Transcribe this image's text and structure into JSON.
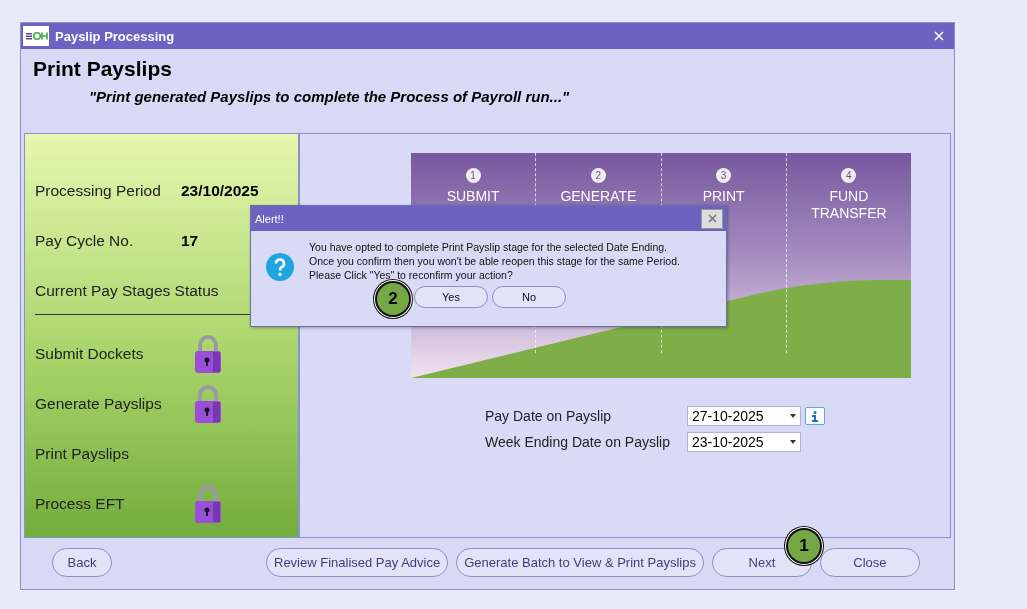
{
  "window": {
    "title": "Payslip Processing"
  },
  "header": {
    "title": "Print Payslips",
    "subtitle": "\"Print generated Payslips to complete the Process of Payroll run...\""
  },
  "summary": [
    {
      "label": "Processing Period",
      "value": "23/10/2025"
    },
    {
      "label": "Pay Cycle No.",
      "value": "17"
    }
  ],
  "status_heading": "Current Pay Stages Status",
  "stages": [
    {
      "label": "Submit Dockets",
      "locked": true
    },
    {
      "label": "Generate Payslips",
      "locked": true
    },
    {
      "label": "Print Payslips",
      "locked": false
    },
    {
      "label": "Process EFT",
      "locked": true
    }
  ],
  "banner_steps": [
    {
      "number": "1",
      "label": "SUBMIT"
    },
    {
      "number": "2",
      "label": "GENERATE"
    },
    {
      "number": "3",
      "label": "PRINT"
    },
    {
      "number": "4",
      "label": "FUND TRANSFER"
    }
  ],
  "fields": [
    {
      "label": "Pay Date on Payslip",
      "value": "27-10-2025",
      "info": true
    },
    {
      "label": "Week Ending Date on Payslip",
      "value": "23-10-2025",
      "info": false
    }
  ],
  "buttons": [
    {
      "label": "Back"
    },
    {
      "label": "Review Finalised Pay Advice"
    },
    {
      "label": "Generate Batch to View & Print Payslips"
    },
    {
      "label": "Next"
    },
    {
      "label": "Close"
    }
  ],
  "dialog": {
    "title": "Alert!!",
    "message": "You have opted to complete Print Payslip stage for the selected Date Ending.\nOnce you confirm then you won't be able reopen this stage for the same Period.\nPlease Click \"Yes\" to reconfirm your action?",
    "buttons": [
      "Yes",
      "No"
    ]
  },
  "callouts": [
    "1",
    "2"
  ]
}
